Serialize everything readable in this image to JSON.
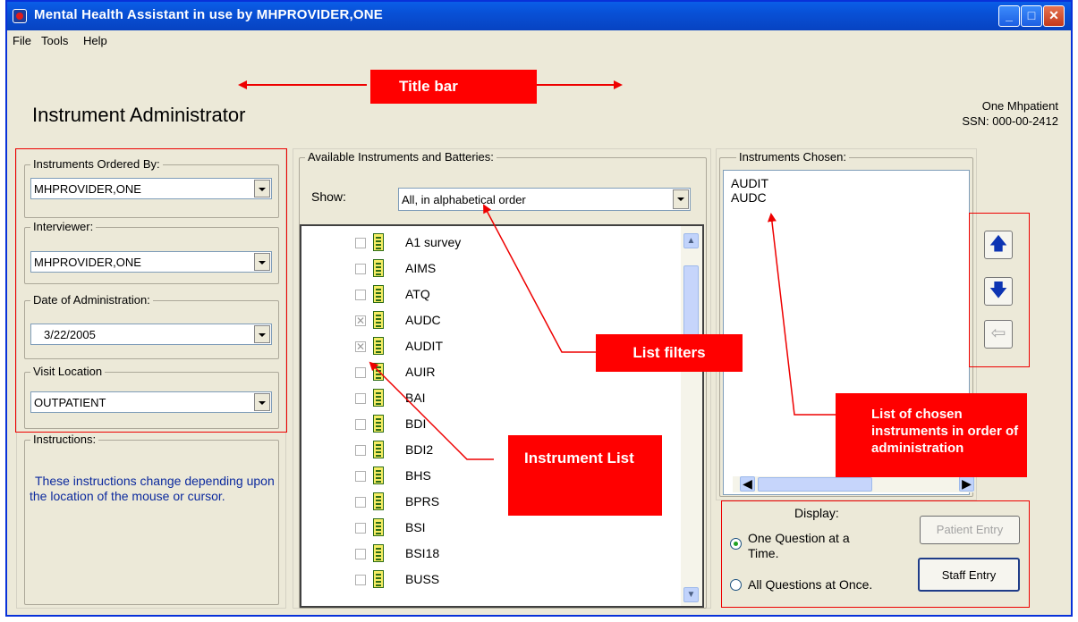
{
  "window": {
    "title": "Mental Health Assistant in use by MHPROVIDER,ONE",
    "controls": [
      "minimize",
      "maximize",
      "close"
    ]
  },
  "menu": [
    "File",
    "Tools",
    "Help"
  ],
  "header": {
    "title": "Instrument Administrator",
    "patient_name": "One Mhpatient",
    "patient_ssn": "SSN: 000-00-2412"
  },
  "left": {
    "ordered_by_label": "Instruments Ordered By:",
    "ordered_by_value": "MHPROVIDER,ONE",
    "interviewer_label": "Interviewer:",
    "interviewer_value": "MHPROVIDER,ONE",
    "date_label": "Date of Administration:",
    "date_value": "3/22/2005",
    "location_label": "Visit Location",
    "location_value": "OUTPATIENT",
    "instructions_label": "Instructions:",
    "instructions_text": "These instructions change depending upon the location of the mouse or cursor."
  },
  "center": {
    "group_label": "Available Instruments and Batteries:",
    "show_label": "Show:",
    "show_value": "All, in alphabetical order",
    "instruments": [
      {
        "name": "A1 survey",
        "checked": false
      },
      {
        "name": "AIMS",
        "checked": false
      },
      {
        "name": "ATQ",
        "checked": false
      },
      {
        "name": "AUDC",
        "checked": true
      },
      {
        "name": "AUDIT",
        "checked": true
      },
      {
        "name": "AUIR",
        "checked": false
      },
      {
        "name": "BAI",
        "checked": false
      },
      {
        "name": "BDI",
        "checked": false
      },
      {
        "name": "BDI2",
        "checked": false
      },
      {
        "name": "BHS",
        "checked": false
      },
      {
        "name": "BPRS",
        "checked": false
      },
      {
        "name": "BSI",
        "checked": false
      },
      {
        "name": "BSI18",
        "checked": false
      },
      {
        "name": "BUSS",
        "checked": false
      }
    ]
  },
  "right": {
    "group_label": "Instruments Chosen:",
    "chosen": [
      "AUDIT",
      "AUDC"
    ],
    "display_label": "Display:",
    "option_one": "One Question at a Time.",
    "option_all": "All Questions at Once.",
    "selected_option": "option_one",
    "patient_entry": "Patient Entry",
    "staff_entry": "Staff Entry"
  },
  "callouts": {
    "title_bar": "Title bar",
    "list_filters": "List filters",
    "instrument_list": "Instrument List",
    "chosen_list": "List of chosen instruments in order of administration"
  },
  "colors": {
    "titlebar": "#0a5ee8",
    "callout": "#ff0000",
    "window_bg": "#ece9d8"
  }
}
